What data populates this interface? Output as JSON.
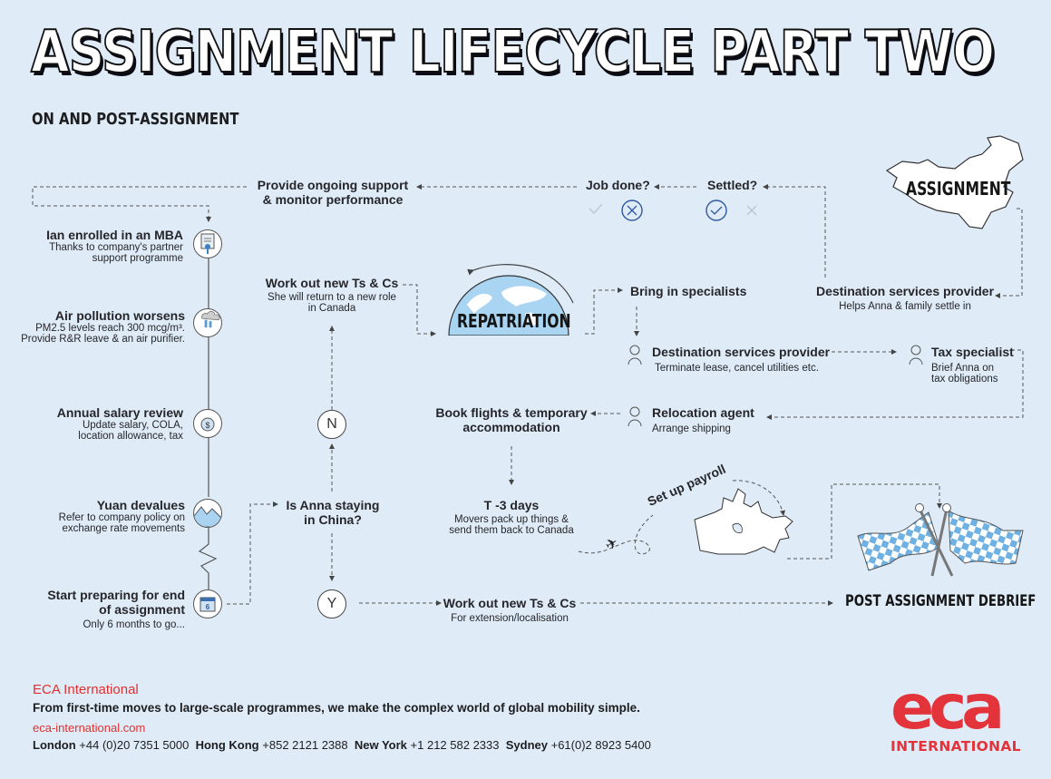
{
  "header": {
    "title": "ASSIGNMENT LIFECYCLE PART TWO",
    "subtitle": "ON AND POST-ASSIGNMENT"
  },
  "timeline": [
    {
      "title": "Ian enrolled in an MBA",
      "lines": [
        "Thanks to company's partner",
        "support programme"
      ],
      "icon": "certificate-icon"
    },
    {
      "title": "Air pollution worsens",
      "lines": [
        "PM2.5 levels reach 300 mcg/m³.",
        "Provide R&R leave & an air purifier."
      ],
      "icon": "factory-smog-icon"
    },
    {
      "title": "Annual salary review",
      "lines": [
        "Update salary, COLA,",
        "location allowance, tax"
      ],
      "icon": "money-bag-icon"
    },
    {
      "title": "Yuan devalues",
      "lines": [
        "Refer to company policy on",
        "exchange rate movements"
      ],
      "icon": "falling-graph-icon"
    },
    {
      "title": "Start preparing for end of assignment",
      "title_lines": [
        "Start preparing for end",
        "of assignment"
      ],
      "lines": [
        "Only 6 months to go..."
      ],
      "icon": "calendar-icon",
      "calendar_day": "6"
    }
  ],
  "flow": {
    "ongoing_support": [
      "Provide ongoing support",
      "& monitor performance"
    ],
    "job_done": {
      "label": "Job done?",
      "check_icon": "check-icon",
      "cross_icon": "cross-circle-icon",
      "selected": "no"
    },
    "settled": {
      "label": "Settled?",
      "check_icon": "check-circle-icon",
      "cross_icon": "cross-icon",
      "selected": "yes"
    },
    "assignment_label": "ASSIGNMENT",
    "destination_provider_top": {
      "title": "Destination services provider",
      "sub": "Helps Anna & family settle in"
    },
    "work_out_canada": {
      "title": "Work out new Ts & Cs",
      "lines": [
        "She will return to a new role",
        "in Canada"
      ]
    },
    "repatriation_label": "REPATRIATION",
    "bring_specialists": "Bring in specialists",
    "destination_provider_mid": {
      "title": "Destination services provider",
      "sub": "Terminate lease, cancel utilities etc."
    },
    "tax_specialist": {
      "title": "Tax specialist",
      "lines": [
        "Brief Anna on",
        "tax obligations"
      ]
    },
    "relocation_agent": {
      "title": "Relocation agent",
      "sub": "Arrange shipping"
    },
    "book_flights": [
      "Book flights & temporary",
      "accommodation"
    ],
    "t_minus": {
      "title": "T -3 days",
      "lines": [
        "Movers pack up things &",
        "send them back to Canada"
      ]
    },
    "set_up_payroll": "Set up payroll",
    "decision": {
      "question": [
        "Is Anna staying",
        "in China?"
      ],
      "no": "N",
      "yes": "Y"
    },
    "work_out_extension": {
      "title": "Work out new Ts & Cs",
      "sub": "For extension/localisation"
    },
    "debrief_label": "POST ASSIGNMENT DEBRIEF"
  },
  "footer": {
    "company": "ECA International",
    "tagline": "From first-time moves to large-scale programmes, we make the complex world of global mobility simple.",
    "url": "eca-international.com",
    "offices": [
      {
        "city": "London",
        "phone": "+44 (0)20 7351 5000"
      },
      {
        "city": "Hong Kong",
        "phone": "+852 2121 2388"
      },
      {
        "city": "New York",
        "phone": "+1 212 582 2333"
      },
      {
        "city": "Sydney",
        "phone": "+61(0)2 8923 5400"
      }
    ],
    "logo_main": "eca",
    "logo_sub": "INTERNATIONAL"
  },
  "colors": {
    "background": "#dfecf8",
    "accent_red": "#e2343a",
    "accent_blue": "#7fb9e4",
    "icon_blue": "#2f5a9e",
    "text": "#26262a"
  }
}
